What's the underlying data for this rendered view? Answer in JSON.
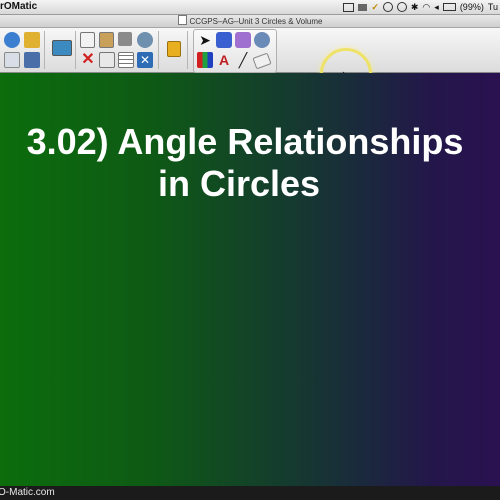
{
  "menubar": {
    "app_name": "rOMatic",
    "battery": "(99%)",
    "clock": "Tu"
  },
  "window": {
    "title": "CCGPS–AG–Unit 3 Circles & Volume"
  },
  "toolbar": {
    "icons": [
      "redo-icon",
      "open-folder-icon",
      "new-page-icon",
      "save-icon",
      "screen-icon",
      "copy-icon",
      "paste-icon",
      "crop-icon",
      "screen-capture-icon",
      "delete-icon",
      "screen-shade-icon",
      "table-icon",
      "close-x-icon",
      "lock-icon",
      "select-arrow-icon",
      "fill-icon",
      "highlighter-icon",
      "magic-pen-icon",
      "pens-icon",
      "text-icon",
      "line-icon",
      "eraser-icon"
    ]
  },
  "slide": {
    "title_line1": "3.02) Angle Relationships",
    "title_line2": "in Circles"
  },
  "footer": {
    "watermark": "O-Matic.com"
  },
  "colors": {
    "gradient_left": "#0c6d0c",
    "gradient_right": "#2a1150",
    "highlight_ring": "#f0e15a"
  }
}
